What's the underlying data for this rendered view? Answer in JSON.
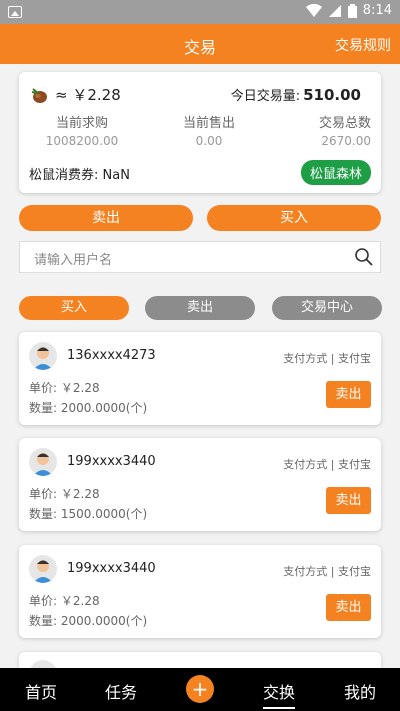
{
  "status_bar": {
    "time": "8:14"
  },
  "header": {
    "title": "交易",
    "rules": "交易规则"
  },
  "summary": {
    "price": "≈ ￥2.28",
    "today_label": "今日交易量:",
    "today_value": "510.00",
    "stats": [
      {
        "label": "当前求购",
        "value": "1008200.00"
      },
      {
        "label": "当前售出",
        "value": "0.00"
      },
      {
        "label": "交易总数",
        "value": "2670.00"
      }
    ],
    "coupon_label": "松鼠消费券:",
    "coupon_value": "NaN",
    "forest_label": "松鼠森林"
  },
  "actions": {
    "sell": "卖出",
    "buy": "买入"
  },
  "search": {
    "placeholder": "请输入用户名"
  },
  "tabs": [
    "买入",
    "卖出",
    "交易中心"
  ],
  "orders": [
    {
      "name": "136xxxx4273",
      "pay": "支付方式 | 支付宝",
      "unit_label": "单价:",
      "unit_value": "￥2.28",
      "qty_label": "数量:",
      "qty_value": "2000.0000(个)",
      "action": "卖出"
    },
    {
      "name": "199xxxx3440",
      "pay": "支付方式 | 支付宝",
      "unit_label": "单价:",
      "unit_value": "￥2.28",
      "qty_label": "数量:",
      "qty_value": "1500.0000(个)",
      "action": "卖出"
    },
    {
      "name": "199xxxx3440",
      "pay": "支付方式 | 支付宝",
      "unit_label": "单价:",
      "unit_value": "￥2.28",
      "qty_label": "数量:",
      "qty_value": "2000.0000(个)",
      "action": "卖出"
    }
  ],
  "bottom_nav": [
    "首页",
    "任务",
    "交换",
    "我的"
  ],
  "colors": {
    "accent": "#f58220",
    "green": "#1e9e45"
  }
}
